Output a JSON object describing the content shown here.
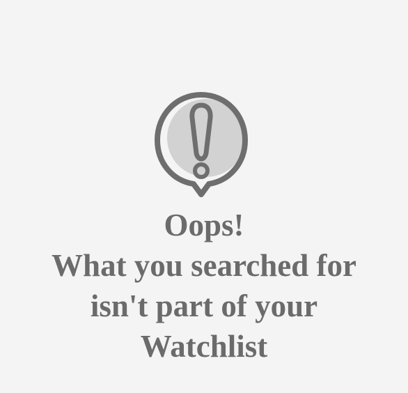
{
  "empty_state": {
    "icon": "exclamation-speech-bubble-icon",
    "title": "Oops!",
    "message_lines": [
      "What you searched for",
      "isn't part of your",
      "Watchlist"
    ]
  },
  "colors": {
    "background": "#f4f4f4",
    "text": "#6b6b6b",
    "icon_stroke": "#6e6e6e",
    "icon_fill": "#d2d2d2"
  }
}
